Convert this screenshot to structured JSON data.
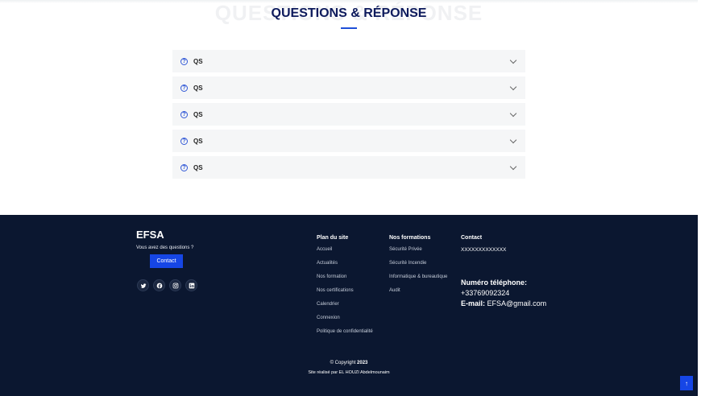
{
  "faq": {
    "background_text": "QUESTIONS & RÉPONSE",
    "title": "QUESTIONS & RÉPONSE",
    "items": [
      {
        "icon": "question-icon",
        "label": "QS"
      },
      {
        "icon": "question-icon",
        "label": "QS"
      },
      {
        "icon": "question-icon",
        "label": "QS"
      },
      {
        "icon": "question-icon",
        "label": "QS"
      },
      {
        "icon": "question-icon",
        "label": "QS"
      }
    ]
  },
  "footer": {
    "brand": "EFSA",
    "subtitle": "Vous avez des questions ?",
    "contact_button": "Contact",
    "socials": [
      "twitter-icon",
      "facebook-icon",
      "instagram-icon",
      "linkedin-icon"
    ],
    "plan": {
      "title": "Plan du site",
      "links": [
        "Accueil",
        "Actualités",
        "Nos formation",
        "Nos certifications",
        "Calendrier",
        "Connexion",
        "Politique de confidentialité"
      ]
    },
    "formations": {
      "title": "Nos formations",
      "links": [
        "Sécurité Privée",
        "Sécurité Incendie",
        "Informatique & bureautique",
        "Audit"
      ]
    },
    "contact": {
      "title": "Contact",
      "value": "XXXXXXXXXXXXX",
      "phone_title": "Numéro téléphone:",
      "phone": "+33769092324",
      "email_label": "E-mail:",
      "email": "EFSA@gmail.com"
    },
    "copyright_prefix": "© Copyright",
    "copyright_year": "2023",
    "credit": "Site réalisé par EL HOUZI Abdelmounaim"
  },
  "colors": {
    "footer_bg": "#0b1730",
    "accent": "#1646e6",
    "title": "#0d1a5c"
  }
}
